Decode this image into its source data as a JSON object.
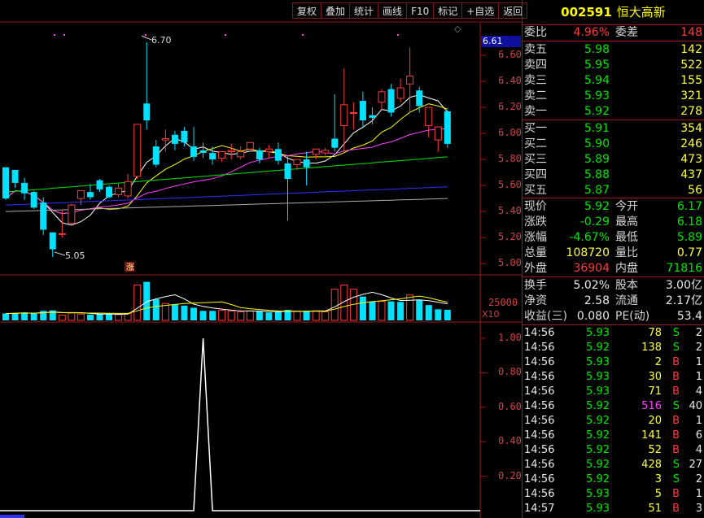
{
  "toolbar": {
    "items": [
      "复权",
      "叠加",
      "统计",
      "画线",
      "F10",
      "标记",
      "+自选",
      "返回"
    ]
  },
  "stock": {
    "code": "002591",
    "name": "恒大高新"
  },
  "weibi": {
    "label1": "委比",
    "value1": "4.96%",
    "label2": "委差",
    "value2": "148"
  },
  "sell": [
    {
      "label": "卖五",
      "price": "5.98",
      "vol": "142"
    },
    {
      "label": "卖四",
      "price": "5.95",
      "vol": "522"
    },
    {
      "label": "卖三",
      "price": "5.94",
      "vol": "155"
    },
    {
      "label": "卖二",
      "price": "5.93",
      "vol": "321"
    },
    {
      "label": "卖一",
      "price": "5.92",
      "vol": "278"
    }
  ],
  "buy": [
    {
      "label": "买一",
      "price": "5.91",
      "vol": "354"
    },
    {
      "label": "买二",
      "price": "5.90",
      "vol": "246"
    },
    {
      "label": "买三",
      "price": "5.89",
      "vol": "473"
    },
    {
      "label": "买四",
      "price": "5.88",
      "vol": "437"
    },
    {
      "label": "买五",
      "price": "5.87",
      "vol": "56"
    }
  ],
  "quote": [
    {
      "l1": "现价",
      "v1": "5.92",
      "c1": "green",
      "l2": "今开",
      "v2": "6.17",
      "c2": "green"
    },
    {
      "l1": "涨跌",
      "v1": "-0.29",
      "c1": "green",
      "l2": "最高",
      "v2": "6.18",
      "c2": "green"
    },
    {
      "l1": "涨幅",
      "v1": "-4.67%",
      "c1": "green",
      "l2": "最低",
      "v2": "5.89",
      "c2": "green"
    },
    {
      "l1": "总量",
      "v1": "108720",
      "c1": "yellow",
      "l2": "量比",
      "v2": "0.77",
      "c2": "yellow"
    },
    {
      "l1": "外盘",
      "v1": "36904",
      "c1": "red",
      "l2": "内盘",
      "v2": "71816",
      "c2": "green"
    }
  ],
  "fin": [
    {
      "l1": "换手",
      "v1": "5.02%",
      "l2": "股本",
      "v2": "3.00亿"
    },
    {
      "l1": "净资",
      "v1": "2.58",
      "l2": "流通",
      "v2": "2.17亿"
    },
    {
      "l1": "收益(三)",
      "v1": "0.080",
      "l2": "PE(动)",
      "v2": "53.4"
    }
  ],
  "trades": [
    {
      "time": "14:56",
      "price": "5.93",
      "vol": "78",
      "side": "S",
      "n": "2",
      "pc": "green",
      "vc": "yellow"
    },
    {
      "time": "14:56",
      "price": "5.92",
      "vol": "138",
      "side": "S",
      "n": "2",
      "pc": "green",
      "vc": "yellow"
    },
    {
      "time": "14:56",
      "price": "5.93",
      "vol": "2",
      "side": "B",
      "n": "1",
      "pc": "green",
      "vc": "yellow"
    },
    {
      "time": "14:56",
      "price": "5.93",
      "vol": "30",
      "side": "B",
      "n": "1",
      "pc": "green",
      "vc": "yellow"
    },
    {
      "time": "14:56",
      "price": "5.93",
      "vol": "71",
      "side": "B",
      "n": "4",
      "pc": "green",
      "vc": "yellow"
    },
    {
      "time": "14:56",
      "price": "5.92",
      "vol": "516",
      "side": "S",
      "n": "40",
      "pc": "green",
      "vc": "mag"
    },
    {
      "time": "14:56",
      "price": "5.92",
      "vol": "20",
      "side": "B",
      "n": "1",
      "pc": "green",
      "vc": "yellow"
    },
    {
      "time": "14:56",
      "price": "5.92",
      "vol": "141",
      "side": "B",
      "n": "6",
      "pc": "green",
      "vc": "yellow"
    },
    {
      "time": "14:56",
      "price": "5.92",
      "vol": "52",
      "side": "B",
      "n": "4",
      "pc": "green",
      "vc": "yellow"
    },
    {
      "time": "14:56",
      "price": "5.92",
      "vol": "428",
      "side": "S",
      "n": "27",
      "pc": "green",
      "vc": "yellow"
    },
    {
      "time": "14:56",
      "price": "5.92",
      "vol": "3",
      "side": "S",
      "n": "2",
      "pc": "green",
      "vc": "yellow"
    },
    {
      "time": "14:56",
      "price": "5.93",
      "vol": "5",
      "side": "B",
      "n": "1",
      "pc": "green",
      "vc": "yellow"
    },
    {
      "time": "14:57",
      "price": "5.93",
      "vol": "51",
      "side": "B",
      "n": "3",
      "pc": "green",
      "vc": "yellow"
    }
  ],
  "chart": {
    "price_ticks": [
      "6.60",
      "6.40",
      "6.20",
      "6.00",
      "5.80",
      "5.60",
      "5.40",
      "5.20",
      "5.00"
    ],
    "current_price": "6.61",
    "high_label": "6.70",
    "low_label": "5.05",
    "limit_up_mark": "涨",
    "volume_tick": "25000",
    "volume_unit": "X10",
    "indicator_ticks": [
      "1.00",
      "0.80",
      "0.60",
      "0.40",
      "0.20"
    ]
  },
  "chart_data": {
    "type": "candlestick",
    "candles": [
      [
        5.74,
        5.72,
        5.5,
        5.49
      ],
      [
        5.72,
        5.68,
        5.62,
        5.58
      ],
      [
        5.62,
        5.66,
        5.54,
        5.49
      ],
      [
        5.55,
        5.56,
        5.43,
        5.42
      ],
      [
        5.47,
        5.51,
        5.26,
        5.22
      ],
      [
        5.24,
        5.24,
        5.11,
        5.05
      ],
      [
        5.23,
        5.41,
        5.23,
        5.2
      ],
      [
        5.31,
        5.46,
        5.45,
        5.3
      ],
      [
        5.5,
        5.56,
        5.56,
        5.45
      ],
      [
        5.55,
        5.61,
        5.51,
        5.49
      ],
      [
        5.64,
        5.65,
        5.57,
        5.55
      ],
      [
        5.59,
        5.6,
        5.51,
        5.5
      ],
      [
        5.53,
        5.62,
        5.58,
        5.51
      ],
      [
        5.52,
        5.69,
        5.63,
        5.5
      ],
      [
        5.67,
        6.0,
        6.07,
        5.65
      ],
      [
        6.23,
        6.7,
        6.1,
        6.03
      ],
      [
        5.9,
        5.95,
        5.76,
        5.74
      ],
      [
        5.95,
        6.03,
        5.96,
        5.86
      ],
      [
        5.99,
        6.02,
        5.92,
        5.87
      ],
      [
        6.02,
        6.05,
        5.93,
        5.9
      ],
      [
        5.9,
        6.05,
        5.82,
        5.79
      ],
      [
        5.87,
        5.93,
        5.85,
        5.81
      ],
      [
        5.85,
        5.9,
        5.8,
        5.76
      ],
      [
        5.81,
        5.86,
        5.86,
        5.78
      ],
      [
        5.86,
        5.92,
        5.87,
        5.8
      ],
      [
        5.82,
        5.9,
        5.86,
        5.8
      ],
      [
        5.88,
        5.92,
        5.93,
        5.86
      ],
      [
        5.87,
        5.89,
        5.8,
        5.77
      ],
      [
        5.86,
        5.91,
        5.88,
        5.81
      ],
      [
        5.88,
        5.93,
        5.79,
        5.76
      ],
      [
        5.77,
        5.83,
        5.65,
        5.33
      ],
      [
        5.76,
        5.8,
        5.8,
        5.72
      ],
      [
        5.8,
        5.86,
        5.74,
        5.6
      ],
      [
        5.84,
        5.88,
        5.88,
        5.8
      ],
      [
        5.85,
        5.89,
        5.87,
        5.83
      ],
      [
        5.96,
        6.3,
        5.89,
        5.86
      ],
      [
        6.06,
        6.5,
        6.22,
        5.86
      ],
      [
        6.16,
        6.24,
        6.16,
        6.03
      ],
      [
        6.25,
        6.32,
        6.1,
        6.04
      ],
      [
        6.14,
        6.2,
        6.12,
        6.07
      ],
      [
        6.24,
        6.34,
        6.32,
        6.18
      ],
      [
        6.34,
        6.38,
        6.16,
        6.13
      ],
      [
        6.27,
        6.42,
        6.35,
        6.24
      ],
      [
        6.38,
        6.66,
        6.44,
        6.17
      ],
      [
        6.33,
        6.36,
        6.21,
        6.16
      ],
      [
        6.06,
        6.15,
        6.2,
        5.97
      ],
      [
        5.95,
        6.04,
        6.05,
        5.86
      ],
      [
        6.17,
        6.18,
        5.92,
        5.89
      ]
    ],
    "volume": [
      [
        1300,
        0
      ],
      [
        1400,
        0
      ],
      [
        1500,
        0
      ],
      [
        1300,
        0
      ],
      [
        1800,
        0
      ],
      [
        1900,
        0
      ],
      [
        1000,
        1
      ],
      [
        1400,
        1
      ],
      [
        1200,
        1
      ],
      [
        1100,
        0
      ],
      [
        1200,
        0
      ],
      [
        1200,
        0
      ],
      [
        1100,
        1
      ],
      [
        1300,
        1
      ],
      [
        6700,
        1
      ],
      [
        7300,
        0
      ],
      [
        4000,
        0
      ],
      [
        3200,
        1
      ],
      [
        3000,
        0
      ],
      [
        2800,
        0
      ],
      [
        2400,
        0
      ],
      [
        1800,
        0
      ],
      [
        1800,
        0
      ],
      [
        1900,
        1
      ],
      [
        1800,
        1
      ],
      [
        1600,
        1
      ],
      [
        1800,
        1
      ],
      [
        1700,
        0
      ],
      [
        1500,
        0
      ],
      [
        1600,
        0
      ],
      [
        2000,
        0
      ],
      [
        1700,
        1
      ],
      [
        1800,
        0
      ],
      [
        1800,
        1
      ],
      [
        1600,
        1
      ],
      [
        5900,
        1
      ],
      [
        6700,
        1
      ],
      [
        5900,
        1
      ],
      [
        4500,
        0
      ],
      [
        3600,
        0
      ],
      [
        3600,
        1
      ],
      [
        3600,
        0
      ],
      [
        3500,
        0
      ],
      [
        4800,
        1
      ],
      [
        3900,
        0
      ],
      [
        2900,
        0
      ],
      [
        2100,
        0
      ],
      [
        2000,
        0
      ]
    ],
    "indicator": {
      "spike_index": 21,
      "values": [
        0,
        1.0,
        0
      ]
    }
  }
}
